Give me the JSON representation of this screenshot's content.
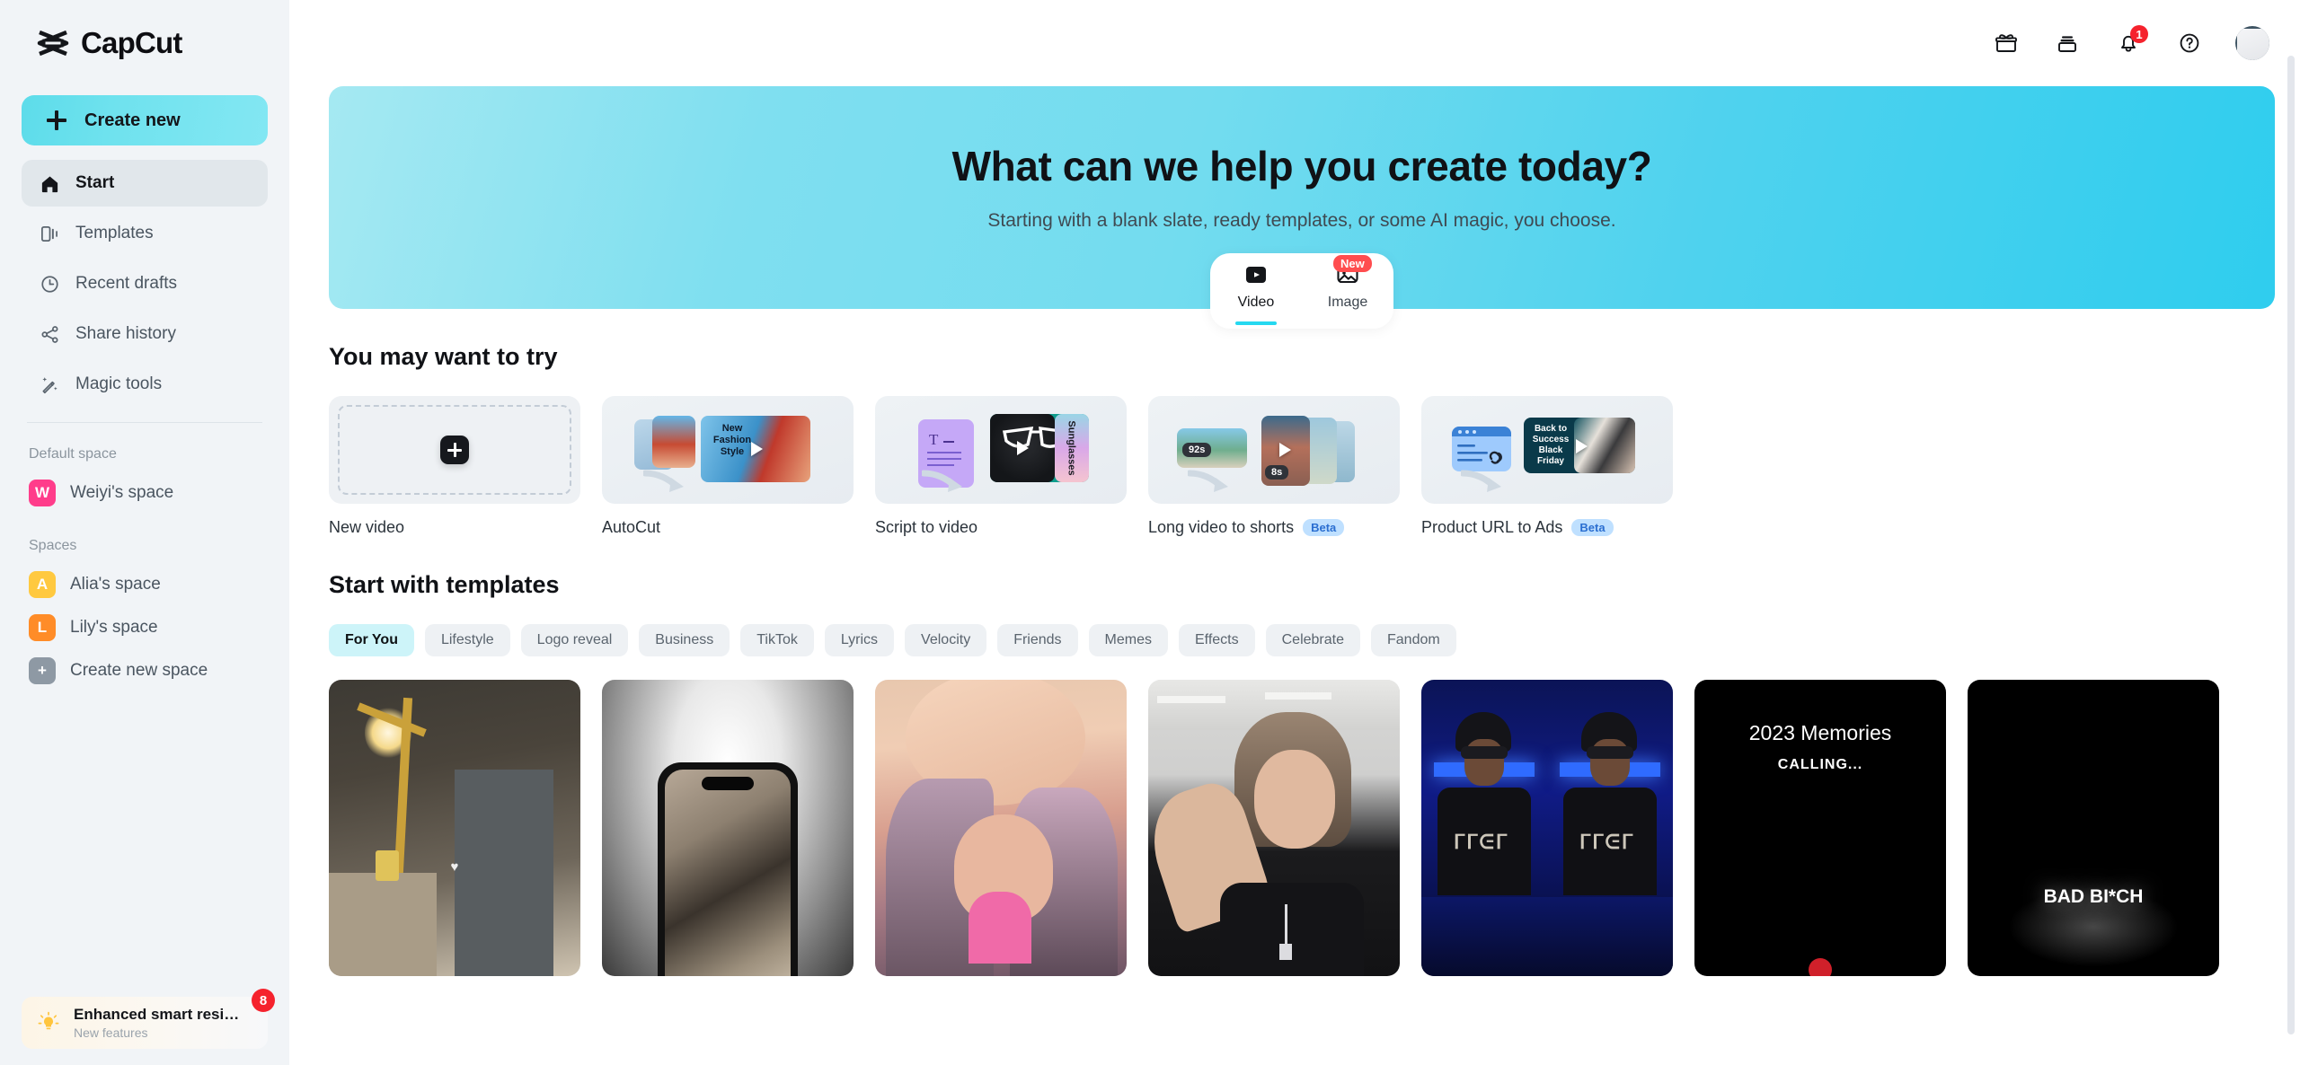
{
  "brand": {
    "name": "CapCut",
    "accent": "#25d8f0"
  },
  "sidebar": {
    "create_new": "Create new",
    "nav": [
      {
        "label": "Start",
        "icon": "home-icon",
        "active": true
      },
      {
        "label": "Templates",
        "icon": "templates-icon",
        "active": false
      },
      {
        "label": "Recent drafts",
        "icon": "clock-icon",
        "active": false
      },
      {
        "label": "Share history",
        "icon": "share-icon",
        "active": false
      },
      {
        "label": "Magic tools",
        "icon": "magic-wand-icon",
        "active": false
      }
    ],
    "default_space_title": "Default space",
    "default_space": {
      "label": "Weiyi's space",
      "initial": "W",
      "color": "#ff3d8b"
    },
    "spaces_title": "Spaces",
    "spaces": [
      {
        "label": "Alia's space",
        "initial": "A",
        "color": "#ffc940"
      },
      {
        "label": "Lily's space",
        "initial": "L",
        "color": "#ff8c28"
      },
      {
        "label": "Create new space",
        "initial": "+",
        "color": "#8e99a4"
      }
    ],
    "promo": {
      "title": "Enhanced smart resi…",
      "subtitle": "New features",
      "badge": "8",
      "icon": "lightbulb-icon"
    }
  },
  "topbar": {
    "icons": [
      {
        "name": "gift-icon"
      },
      {
        "name": "cards-icon"
      },
      {
        "name": "bell-icon",
        "badge": "1"
      },
      {
        "name": "help-icon"
      }
    ],
    "avatar": "user-avatar"
  },
  "hero": {
    "title": "What can we help you create today?",
    "subtitle": "Starting with a blank slate, ready templates, or some AI magic, you choose."
  },
  "mode_switch": [
    {
      "label": "Video",
      "icon": "play-video-icon",
      "active": true,
      "badge": ""
    },
    {
      "label": "Image",
      "icon": "image-icon",
      "active": false,
      "badge": "New"
    }
  ],
  "try_section": {
    "title": "You may want to try",
    "cards": [
      {
        "label": "New video",
        "badge": "",
        "kind": "blank"
      },
      {
        "label": "AutoCut",
        "badge": "",
        "kind": "autocut",
        "overlay_text": "New\nFashion\nStyle"
      },
      {
        "label": "Script to video",
        "badge": "",
        "kind": "script",
        "overlay_text": "Sunglasses"
      },
      {
        "label": "Long video to shorts",
        "badge": "Beta",
        "kind": "shorts",
        "tag_a": "92s",
        "tag_b": "8s"
      },
      {
        "label": "Product URL to Ads",
        "badge": "Beta",
        "kind": "url-ads",
        "overlay_text": "Back to Success Black Friday"
      }
    ]
  },
  "templates_section": {
    "title": "Start with templates",
    "chips": [
      {
        "label": "For You",
        "active": true
      },
      {
        "label": "Lifestyle",
        "active": false
      },
      {
        "label": "Logo reveal",
        "active": false
      },
      {
        "label": "Business",
        "active": false
      },
      {
        "label": "TikTok",
        "active": false
      },
      {
        "label": "Lyrics",
        "active": false
      },
      {
        "label": "Velocity",
        "active": false
      },
      {
        "label": "Friends",
        "active": false
      },
      {
        "label": "Memes",
        "active": false
      },
      {
        "label": "Effects",
        "active": false
      },
      {
        "label": "Celebrate",
        "active": false
      },
      {
        "label": "Fandom",
        "active": false
      }
    ],
    "thumbs": [
      {
        "name": "snowy-night-street",
        "caption": "",
        "caption2": "",
        "bottom": ""
      },
      {
        "name": "iphone-titanium",
        "caption": "",
        "caption2": "",
        "bottom": ""
      },
      {
        "name": "portrait-blonde",
        "caption": "",
        "caption2": "",
        "bottom": ""
      },
      {
        "name": "portrait-hair-sweep",
        "caption": "",
        "caption2": "",
        "bottom": ""
      },
      {
        "name": "blue-room-duo",
        "caption": "",
        "caption2": "",
        "bottom": ""
      },
      {
        "name": "2023-memories",
        "caption": "2023 Memories",
        "caption2": "CALLING...",
        "bottom": ""
      },
      {
        "name": "bad-bich",
        "caption": "",
        "caption2": "",
        "bottom": "BAD BI*CH"
      }
    ]
  }
}
